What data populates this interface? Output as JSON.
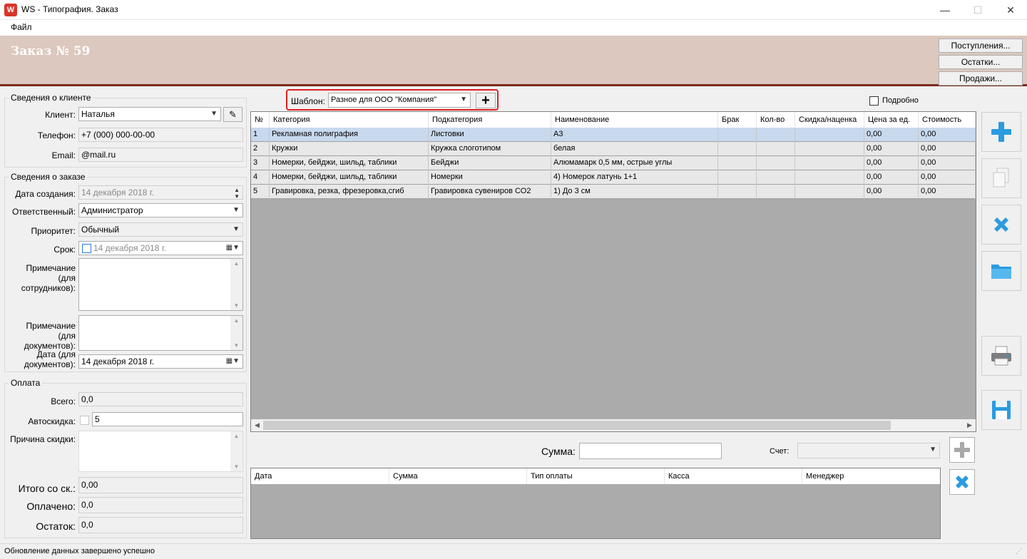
{
  "window": {
    "title": "WS - Типография. Заказ",
    "minimize": "—",
    "maximize": "☐",
    "close": "✕"
  },
  "menu": {
    "file": "Файл"
  },
  "header": {
    "title": "Заказ № 59",
    "buttons": {
      "receipts": "Поступления...",
      "stock": "Остатки...",
      "sales": "Продажи..."
    }
  },
  "client": {
    "group_title": "Сведения о клиенте",
    "client_label": "Клиент:",
    "client_value": "Наталья",
    "phone_label": "Телефон:",
    "phone_value": "+7 (000) 000-00-00",
    "email_label": "Email:",
    "email_value": "@mail.ru"
  },
  "order": {
    "group_title": "Сведения о заказе",
    "created_label": "Дата создания:",
    "created_value": "14 декабря  2018 г.",
    "responsible_label": "Ответственный:",
    "responsible_value": "Администратор",
    "priority_label": "Приоритет:",
    "priority_value": "Обычный",
    "deadline_label": "Срок:",
    "deadline_value": "14 декабря  2018 г.",
    "note_staff_label": "Примечание (для сотрудников):",
    "note_docs_label": "Примечание (для документов):",
    "doc_date_label": "Дата (для документов):",
    "doc_date_value": "14 декабря  2018 г."
  },
  "payment": {
    "group_title": "Оплата",
    "total_label": "Всего:",
    "total_value": "0,0",
    "autodiscount_label": "Автоскидка:",
    "autodiscount_value": "5",
    "discount_reason_label": "Причина скидки:",
    "total_discounted_label": "Итого со ск.:",
    "total_discounted_value": "0,00",
    "paid_label": "Оплачено:",
    "paid_value": "0,0",
    "remaining_label": "Остаток:",
    "remaining_value": "0,0"
  },
  "template": {
    "label": "Шаблон:",
    "value": "Разное для ООО \"Компания\"",
    "add_label": "+",
    "detailed_label": "Подробно"
  },
  "items_table": {
    "columns": [
      "№",
      "Категория",
      "Подкатегория",
      "Наименование",
      "Брак",
      "Кол-во",
      "Скидка/наценка",
      "Цена за ед.",
      "Стоимость"
    ],
    "rows": [
      [
        "1",
        "Рекламная полиграфия",
        "Листовки",
        "А3",
        "",
        "",
        "",
        "0,00",
        "0,00"
      ],
      [
        "2",
        "Кружки",
        "Кружка слоготипом",
        "белая",
        "",
        "",
        "",
        "0,00",
        "0,00"
      ],
      [
        "3",
        "Номерки, бейджи, шильд, таблики",
        "Бейджи",
        "Алюмамарк 0,5 мм, острые углы",
        "",
        "",
        "",
        "0,00",
        "0,00"
      ],
      [
        "4",
        "Номерки, бейджи, шильд, таблики",
        "Номерки",
        "4) Номерок латунь 1+1",
        "",
        "",
        "",
        "0,00",
        "0,00"
      ],
      [
        "5",
        "Гравировка, резка, фрезеровка,сгиб",
        "Гравировка сувениров СО2",
        "1) До 3 см",
        "",
        "",
        "",
        "0,00",
        "0,00"
      ]
    ]
  },
  "sum": {
    "label": "Сумма:",
    "value": "",
    "account_label": "Счет:",
    "account_value": ""
  },
  "payments_table": {
    "columns": [
      "Дата",
      "Сумма",
      "Тип оплаты",
      "Касса",
      "Менеджер"
    ]
  },
  "side_buttons": {
    "add": "plus-icon",
    "copy": "copy-icon",
    "delete": "delete-icon",
    "open": "folder-icon",
    "print": "printer-icon",
    "save": "save-icon"
  },
  "colors": {
    "header_band": "#dcc8bf",
    "header_border": "#7a2a1e",
    "accent_blue": "#2b9be0",
    "highlight_red": "#e02020"
  },
  "status": {
    "text": "Обновление данных завершено успешно"
  }
}
